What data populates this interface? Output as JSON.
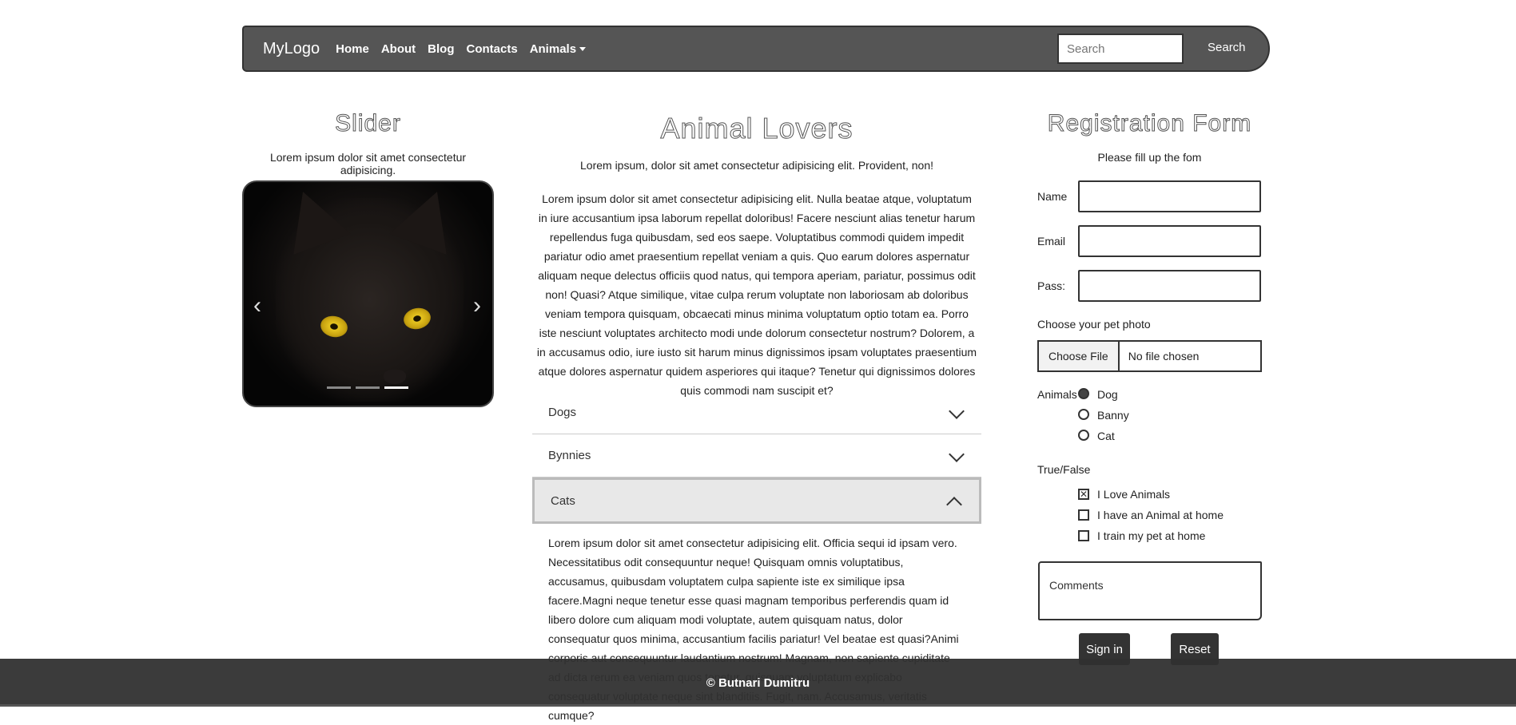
{
  "navbar": {
    "brand": "MyLogo",
    "links": [
      "Home",
      "About",
      "Blog",
      "Contacts",
      "Animals"
    ],
    "search_placeholder": "Search",
    "search_button": "Search"
  },
  "slider": {
    "title": "Slider",
    "subtitle": "Lorem ipsum dolor sit amet consectetur adipisicing.",
    "prev": "‹",
    "next": "›",
    "slide_count": 3,
    "active_slide": 3
  },
  "main": {
    "title": "Animal Lovers",
    "subtitle": "Lorem ipsum, dolor sit amet consectetur adipisicing elit. Provident, non!",
    "paragraph": "Lorem ipsum dolor sit amet consectetur adipisicing elit. Nulla beatae atque, voluptatum in iure accusantium ipsa laborum repellat doloribus! Facere nesciunt alias tenetur harum repellendus fuga quibusdam, sed eos saepe. Voluptatibus commodi quidem impedit pariatur odio amet praesentium repellat veniam a quis. Quo earum dolores aspernatur aliquam neque delectus officiis quod natus, qui tempora aperiam, pariatur, possimus odit non! Quasi? Atque similique, vitae culpa rerum voluptate non laboriosam ab doloribus veniam tempora quisquam, obcaecati minus minima voluptatum optio totam ea. Porro iste nesciunt voluptates architecto modi unde dolorum consectetur nostrum? Dolorem, a in accusamus odio, iure iusto sit harum minus dignissimos ipsam voluptates praesentium atque dolores aspernatur quidem asperiores qui itaque? Tenetur qui dignissimos dolores quis commodi nam suscipit et?",
    "accordion": [
      {
        "label": "Dogs",
        "open": false
      },
      {
        "label": "Bynnies",
        "open": false
      },
      {
        "label": "Cats",
        "open": true
      }
    ],
    "accordion_body": "Lorem ipsum dolor sit amet consectetur adipisicing elit. Officia sequi id ipsam vero. Necessitatibus odit consequuntur neque! Quisquam omnis voluptatibus, accusamus, quibusdam voluptatem culpa sapiente iste ex similique ipsa facere.Magni neque tenetur esse quasi magnam temporibus perferendis quam id libero dolore cum aliquam modi voluptate, autem quisquam natus, dolor consequatur quos minima, accusantium facilis pariatur! Vel beatae est quasi?Animi corporis aut consequuntur laudantium nostrum! Magnam, non sapiente cupiditate ad dicta rerum ea veniam quos tenetur, quisquam voluptatum explicabo consequatur voluptate neque sint blanditiis. Fugit, nam. Accusamus, veritatis cumque?"
  },
  "form": {
    "title": "Registration Form",
    "subtitle": "Please fill up the fom",
    "name_label": "Name",
    "email_label": "Email",
    "pass_label": "Pass:",
    "photo_label": "Choose your pet photo",
    "file_button": "Choose File",
    "file_status": "No file chosen",
    "animals_label": "Animals",
    "animals": [
      {
        "label": "Dog",
        "checked": true
      },
      {
        "label": "Banny",
        "checked": false
      },
      {
        "label": "Cat",
        "checked": false
      }
    ],
    "truefalse_label": "True/False",
    "checks": [
      {
        "label": "I Love Animals",
        "checked": true
      },
      {
        "label": "I have an Animal at home",
        "checked": false
      },
      {
        "label": "I train my pet at home",
        "checked": false
      }
    ],
    "comments_placeholder": "Comments",
    "signin_button": "Sign in",
    "reset_button": "Reset"
  },
  "footer": {
    "text": "© Butnari Dumitru"
  }
}
